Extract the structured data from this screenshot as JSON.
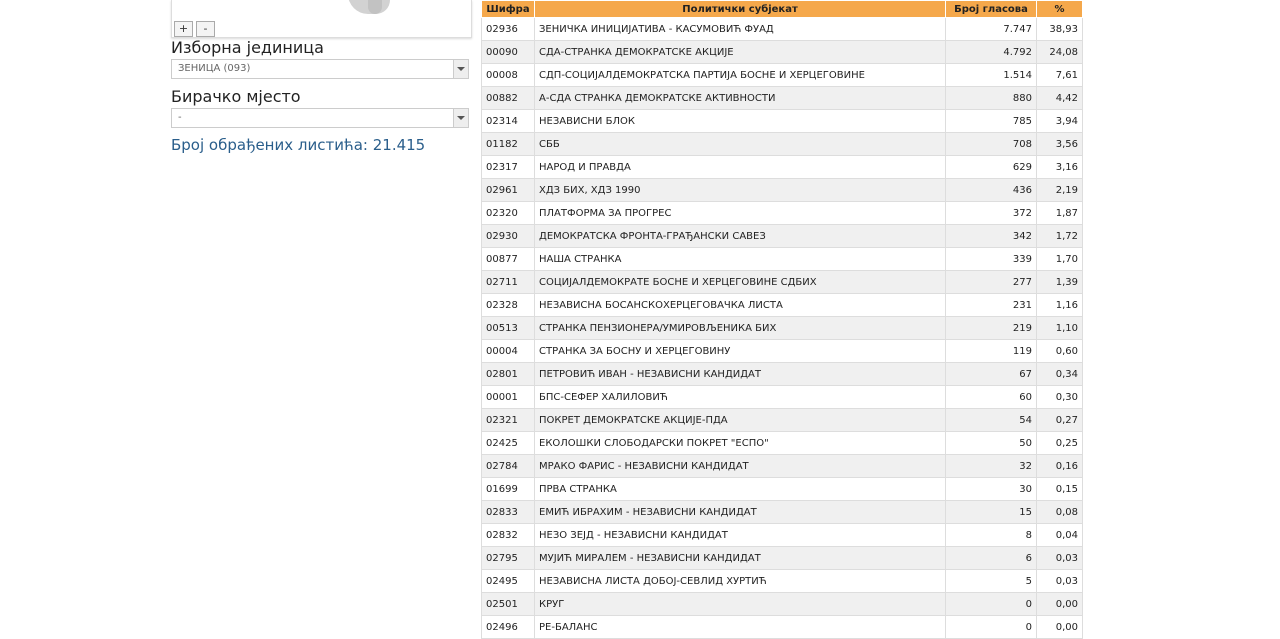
{
  "map": {
    "zoom_in": "+",
    "zoom_out": "-"
  },
  "filters": {
    "unit_label": "Изборна јединица",
    "unit_value": "ЗЕНИЦА (093)",
    "station_label": "Бирачко мјесто",
    "station_value": "-"
  },
  "summary": "Број обрађених листића: 21.415",
  "table": {
    "headers": {
      "code": "Шифра",
      "party": "Политички субјекат",
      "votes": "Број гласова",
      "pct": "%"
    },
    "rows": [
      {
        "code": "02936",
        "party": "ЗЕНИЧКА ИНИЦИЈАТИВА - КАСУМОВИЋ ФУАД",
        "votes": "7.747",
        "pct": "38,93"
      },
      {
        "code": "00090",
        "party": "СДА-СТРАНКА ДЕМОКРАТСКЕ АКЦИЈЕ",
        "votes": "4.792",
        "pct": "24,08"
      },
      {
        "code": "00008",
        "party": "СДП-СОЦИЈАЛДЕМОКРАТСКА ПАРТИЈА БОСНЕ И ХЕРЦЕГОВИНЕ",
        "votes": "1.514",
        "pct": "7,61"
      },
      {
        "code": "00882",
        "party": "А-СДА СТРАНКА ДЕМОКРАТСКЕ АКТИВНОСТИ",
        "votes": "880",
        "pct": "4,42"
      },
      {
        "code": "02314",
        "party": "НЕЗАВИСНИ БЛОК",
        "votes": "785",
        "pct": "3,94"
      },
      {
        "code": "01182",
        "party": "СББ",
        "votes": "708",
        "pct": "3,56"
      },
      {
        "code": "02317",
        "party": "НАРОД И ПРАВДА",
        "votes": "629",
        "pct": "3,16"
      },
      {
        "code": "02961",
        "party": "ХДЗ БИХ, ХДЗ 1990",
        "votes": "436",
        "pct": "2,19"
      },
      {
        "code": "02320",
        "party": "ПЛАТФОРМА ЗА ПРОГРЕС",
        "votes": "372",
        "pct": "1,87"
      },
      {
        "code": "02930",
        "party": "ДЕМОКРАТСКА ФРОНТА-ГРАЂАНСКИ САВЕЗ",
        "votes": "342",
        "pct": "1,72"
      },
      {
        "code": "00877",
        "party": "НАША СТРАНКА",
        "votes": "339",
        "pct": "1,70"
      },
      {
        "code": "02711",
        "party": "СОЦИЈАЛДЕМОКРАТЕ БОСНЕ И ХЕРЦЕГОВИНЕ СДБИХ",
        "votes": "277",
        "pct": "1,39"
      },
      {
        "code": "02328",
        "party": "НЕЗАВИСНА БОСАНСКОХЕРЦЕГОВАЧКА ЛИСТА",
        "votes": "231",
        "pct": "1,16"
      },
      {
        "code": "00513",
        "party": "СТРАНКА ПЕНЗИОНЕРА/УМИРОВЉЕНИКА БИХ",
        "votes": "219",
        "pct": "1,10"
      },
      {
        "code": "00004",
        "party": "СТРАНКА ЗА БОСНУ И ХЕРЦЕГОВИНУ",
        "votes": "119",
        "pct": "0,60"
      },
      {
        "code": "02801",
        "party": "ПЕТРОВИЋ ИВАН - НЕЗАВИСНИ КАНДИДАТ",
        "votes": "67",
        "pct": "0,34"
      },
      {
        "code": "00001",
        "party": "БПС-СЕФЕР ХАЛИЛОВИЋ",
        "votes": "60",
        "pct": "0,30"
      },
      {
        "code": "02321",
        "party": "ПОКРЕТ ДЕМОКРАТСКЕ АКЦИЈЕ-ПДА",
        "votes": "54",
        "pct": "0,27"
      },
      {
        "code": "02425",
        "party": "ЕКОЛОШКИ СЛОБОДАРСКИ ПОКРЕТ \"ЕСПО\"",
        "votes": "50",
        "pct": "0,25"
      },
      {
        "code": "02784",
        "party": "МРАКО ФАРИС - НЕЗАВИСНИ КАНДИДАТ",
        "votes": "32",
        "pct": "0,16"
      },
      {
        "code": "01699",
        "party": "ПРВА СТРАНКА",
        "votes": "30",
        "pct": "0,15"
      },
      {
        "code": "02833",
        "party": "ЕМИЋ ИБРАХИМ - НЕЗАВИСНИ КАНДИДАТ",
        "votes": "15",
        "pct": "0,08"
      },
      {
        "code": "02832",
        "party": "НЕЗО ЗЕЈД - НЕЗАВИСНИ КАНДИДАТ",
        "votes": "8",
        "pct": "0,04"
      },
      {
        "code": "02795",
        "party": "МУЈИЋ МИРАЛЕМ - НЕЗАВИСНИ КАНДИДАТ",
        "votes": "6",
        "pct": "0,03"
      },
      {
        "code": "02495",
        "party": "НЕЗАВИСНА ЛИСТА ДОБОЈ-СЕВЛИД ХУРТИЋ",
        "votes": "5",
        "pct": "0,03"
      },
      {
        "code": "02501",
        "party": "КРУГ",
        "votes": "0",
        "pct": "0,00"
      },
      {
        "code": "02496",
        "party": "РЕ-БАЛАНС",
        "votes": "0",
        "pct": "0,00"
      }
    ]
  }
}
